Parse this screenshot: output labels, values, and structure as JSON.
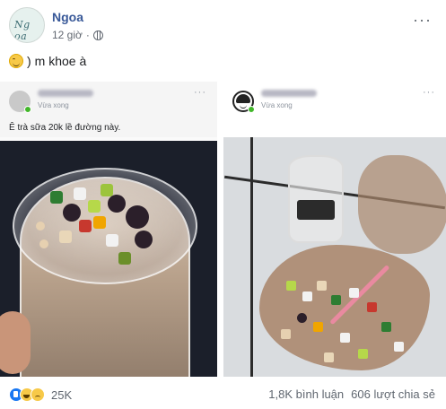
{
  "post": {
    "author": "Ngoa",
    "avatar_text": "Ng oa",
    "time": "12 giờ",
    "audience_icon": "globe-icon",
    "more_label": "···",
    "text": "m khoe à",
    "emoji": "smiling-face-icon"
  },
  "screenshots": [
    {
      "status": "Vừa xong",
      "caption": "Ê trà sữa 20k lề đường này.",
      "menu_label": "···"
    },
    {
      "status": "Vừa xong",
      "caption": "",
      "menu_label": "···"
    }
  ],
  "footer": {
    "reactions": [
      "like",
      "haha",
      "sad"
    ],
    "reaction_count": "25K",
    "comments": "1,8K bình luận",
    "shares": "606 lượt chia sẻ"
  }
}
